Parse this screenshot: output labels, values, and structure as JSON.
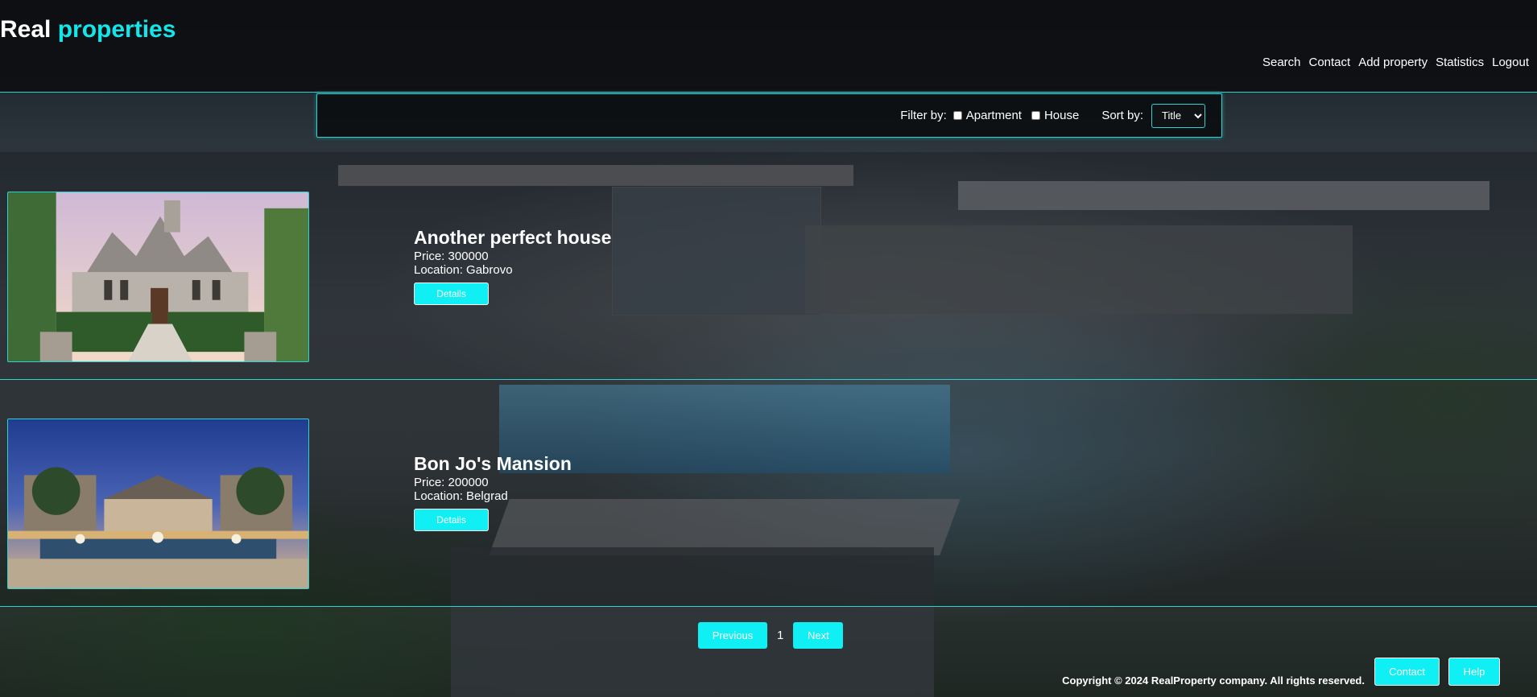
{
  "header": {
    "logo_main": "Real",
    "logo_accent": "properties",
    "nav": [
      "Search",
      "Contact",
      "Add property",
      "Statistics",
      "Logout"
    ]
  },
  "filter": {
    "filter_label": "Filter by:",
    "options": [
      "Apartment",
      "House"
    ],
    "sort_label": "Sort by:",
    "sort_value": "Title"
  },
  "listings": [
    {
      "title": "Another perfect house",
      "price": "Price: 300000",
      "location": "Location: Gabrovo",
      "button": "Details"
    },
    {
      "title": "Bon Jo's Mansion",
      "price": "Price: 200000",
      "location": "Location: Belgrad",
      "button": "Details"
    }
  ],
  "pagination": {
    "previous": "Previous",
    "page": "1",
    "next": "Next"
  },
  "footer": {
    "copyright": "Copyright © 2024 RealProperty company. All rights reserved.",
    "contact": "Contact",
    "help": "Help"
  },
  "colors": {
    "accent": "#13e6ea",
    "button": "#10f0f4",
    "header_bg": "#0c0e10"
  }
}
